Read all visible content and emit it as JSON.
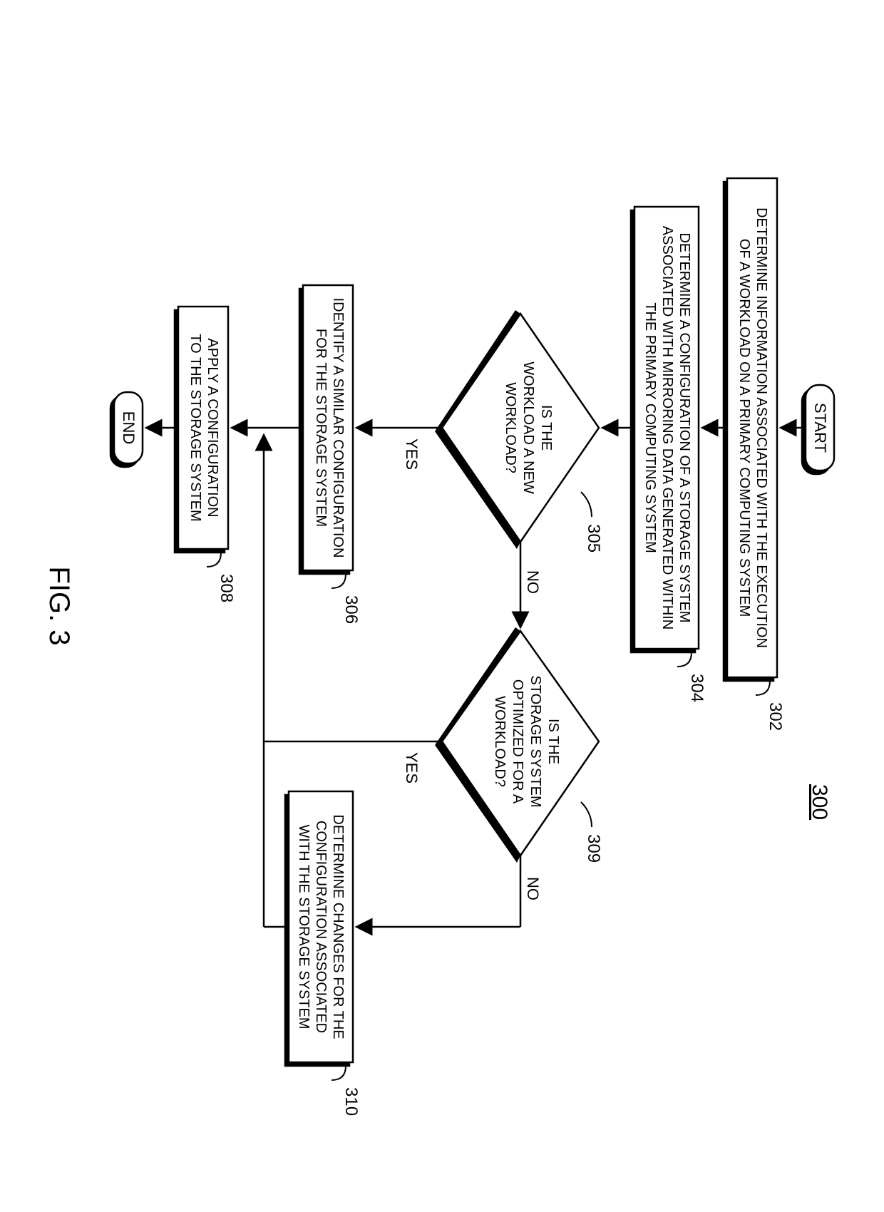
{
  "figure_label": "FIG. 3",
  "figure_number": "300",
  "nodes": {
    "start": "START",
    "end": "END",
    "step302": "DETERMINE INFORMATION ASSOCIATED WITH THE EXECUTION OF A WORKLOAD ON A PRIMARY COMPUTING SYSTEM",
    "step304": "DETERMINE A CONFIGURATION OF A STORAGE SYSTEM ASSOCIATED WITH MIRRORING DATA GENERATED WITHIN THE PRIMARY COMPUTING SYSTEM",
    "dec305": "IS THE WORKLOAD A NEW WORKLOAD?",
    "step306": "IDENTIFY A SIMILAR CONFIGURATION FOR THE STORAGE SYSTEM",
    "step308": "APPLY A CONFIGURATION TO THE STORAGE SYSTEM",
    "dec309": "IS THE STORAGE SYSTEM OPTIMIZED FOR A WORKLOAD?",
    "step310": "DETERMINE CHANGES FOR THE CONFIGURATION ASSOCIATED WITH THE STORAGE SYSTEM"
  },
  "labels": {
    "l302": "302",
    "l304": "304",
    "l305": "305",
    "l306": "306",
    "l308": "308",
    "l309": "309",
    "l310": "310",
    "yes": "YES",
    "no": "NO"
  },
  "chart_data": {
    "type": "flowchart",
    "nodes": [
      {
        "id": "start",
        "kind": "terminator",
        "text": "START"
      },
      {
        "id": "302",
        "kind": "process",
        "text": "DETERMINE INFORMATION ASSOCIATED WITH THE EXECUTION OF A WORKLOAD ON A PRIMARY COMPUTING SYSTEM"
      },
      {
        "id": "304",
        "kind": "process",
        "text": "DETERMINE A CONFIGURATION OF A STORAGE SYSTEM ASSOCIATED WITH MIRRORING DATA GENERATED WITHIN THE PRIMARY COMPUTING SYSTEM"
      },
      {
        "id": "305",
        "kind": "decision",
        "text": "IS THE WORKLOAD A NEW WORKLOAD?"
      },
      {
        "id": "306",
        "kind": "process",
        "text": "IDENTIFY A SIMILAR CONFIGURATION FOR THE STORAGE SYSTEM"
      },
      {
        "id": "308",
        "kind": "process",
        "text": "APPLY A CONFIGURATION TO THE STORAGE SYSTEM"
      },
      {
        "id": "309",
        "kind": "decision",
        "text": "IS THE STORAGE SYSTEM OPTIMIZED FOR A WORKLOAD?"
      },
      {
        "id": "310",
        "kind": "process",
        "text": "DETERMINE CHANGES FOR THE CONFIGURATION ASSOCIATED WITH THE STORAGE SYSTEM"
      },
      {
        "id": "end",
        "kind": "terminator",
        "text": "END"
      }
    ],
    "edges": [
      {
        "from": "start",
        "to": "302"
      },
      {
        "from": "302",
        "to": "304"
      },
      {
        "from": "304",
        "to": "305"
      },
      {
        "from": "305",
        "to": "306",
        "label": "YES"
      },
      {
        "from": "305",
        "to": "309",
        "label": "NO"
      },
      {
        "from": "306",
        "to": "308"
      },
      {
        "from": "309",
        "to": "308",
        "label": "YES",
        "note": "merges into line above 308"
      },
      {
        "from": "309",
        "to": "310",
        "label": "NO"
      },
      {
        "from": "310",
        "to": "308",
        "note": "routes back to line above 308"
      },
      {
        "from": "308",
        "to": "end"
      }
    ]
  }
}
